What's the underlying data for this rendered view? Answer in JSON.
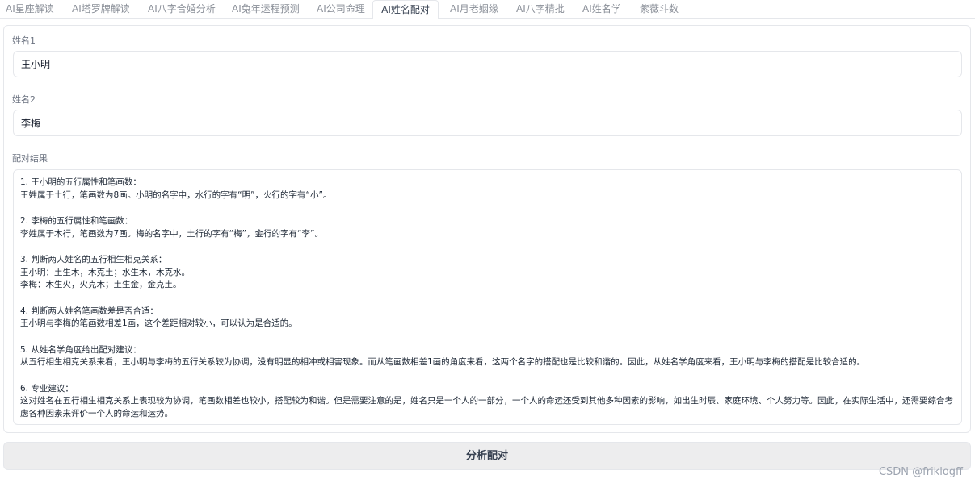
{
  "tabs": [
    {
      "label": "AI星座解读",
      "active": false
    },
    {
      "label": "AI塔罗牌解读",
      "active": false
    },
    {
      "label": "AI八字合婚分析",
      "active": false
    },
    {
      "label": "AI兔年运程预测",
      "active": false
    },
    {
      "label": "AI公司命理",
      "active": false
    },
    {
      "label": "AI姓名配对",
      "active": true
    },
    {
      "label": "AI月老姻缘",
      "active": false
    },
    {
      "label": "AI八字精批",
      "active": false
    },
    {
      "label": "AI姓名学",
      "active": false
    },
    {
      "label": "紫薇斗数",
      "active": false
    }
  ],
  "form": {
    "name1_label": "姓名1",
    "name1_value": "王小明",
    "name2_label": "姓名2",
    "name2_value": "李梅",
    "result_label": "配对结果",
    "submit_label": "分析配对"
  },
  "result": {
    "sections": [
      {
        "heading": "1. 王小明的五行属性和笔画数：",
        "lines": [
          "王姓属于土行，笔画数为8画。小明的名字中，水行的字有“明”，火行的字有“小”。"
        ]
      },
      {
        "heading": "2. 李梅的五行属性和笔画数：",
        "lines": [
          "李姓属于木行，笔画数为7画。梅的名字中，土行的字有“梅”，金行的字有“李”。"
        ]
      },
      {
        "heading": "3. 判断两人姓名的五行相生相克关系：",
        "lines": [
          "王小明：土生木，木克土；水生木，木克水。",
          "李梅：木生火，火克木；土生金，金克土。"
        ]
      },
      {
        "heading": "4. 判断两人姓名笔画数差是否合适：",
        "lines": [
          "王小明与李梅的笔画数相差1画，这个差距相对较小，可以认为是合适的。"
        ]
      },
      {
        "heading": "5. 从姓名学角度给出配对建议：",
        "lines": [
          "从五行相生相克关系来看，王小明与李梅的五行关系较为协调，没有明显的相冲或相害现象。而从笔画数相差1画的角度来看，这两个名字的搭配也是比较和谐的。因此，从姓名学角度来看，王小明与李梅的搭配是比较合适的。"
        ]
      },
      {
        "heading": "6. 专业建议：",
        "lines": [
          "这对姓名在五行相生相克关系上表现较为协调，笔画数相差也较小，搭配较为和谐。但是需要注意的是，姓名只是一个人的一部分，一个人的命运还受到其他多种因素的影响，如出生时辰、家庭环境、个人努力等。因此，在实际生活中，还需要综合考虑各种因素来评价一个人的命运和运势。"
        ]
      }
    ]
  },
  "watermark": "CSDN @friklogff"
}
